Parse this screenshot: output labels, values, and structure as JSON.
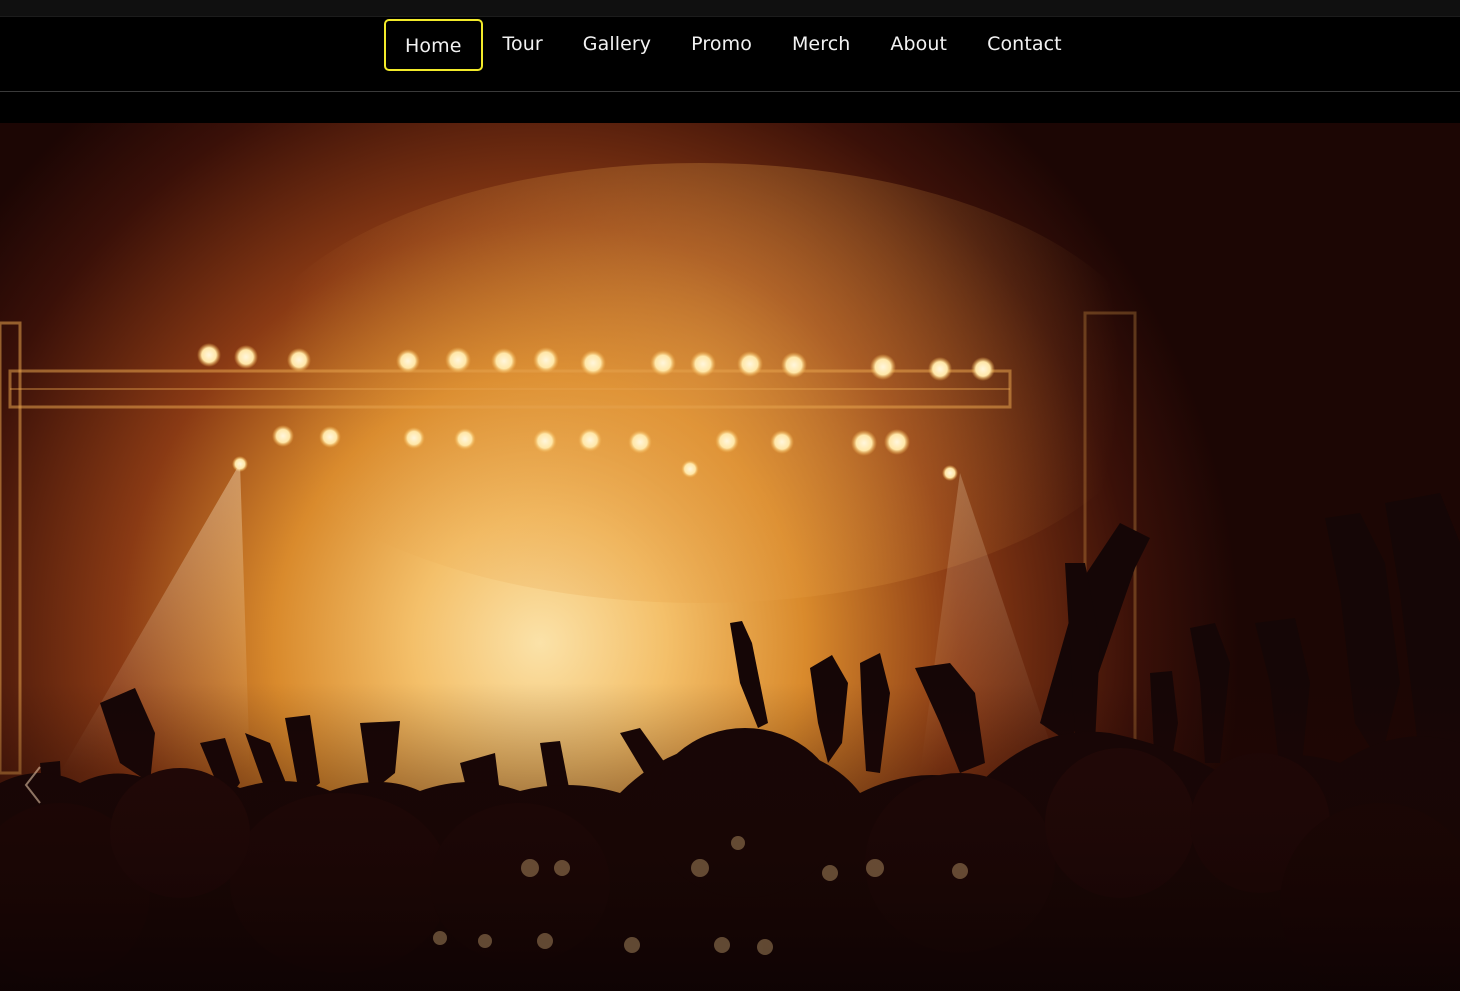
{
  "nav": {
    "items": [
      {
        "label": "Home",
        "active": true
      },
      {
        "label": "Tour",
        "active": false
      },
      {
        "label": "Gallery",
        "active": false
      },
      {
        "label": "Promo",
        "active": false
      },
      {
        "label": "Merch",
        "active": false
      },
      {
        "label": "About",
        "active": false
      },
      {
        "label": "Contact",
        "active": false
      }
    ]
  },
  "hero": {
    "image_subject": "concert crowd silhouettes under orange stage lights",
    "prev_icon": "chevron-left-icon"
  },
  "colors": {
    "background": "#000000",
    "nav_text": "#f2f2f2",
    "active_border": "#f2ea2a",
    "stage_glow": "#f6c77a",
    "smoke_orange": "#d8842a",
    "crowd_dark": "#140505"
  }
}
